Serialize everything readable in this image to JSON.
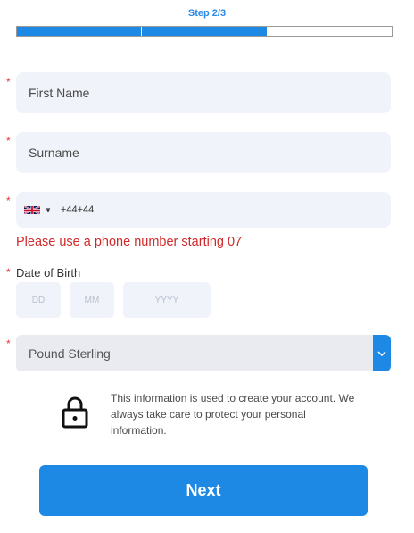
{
  "header": {
    "step_label": "Step 2/3",
    "progress": {
      "current_step": 2,
      "total_steps": 3
    }
  },
  "form": {
    "first_name": {
      "placeholder": "First Name",
      "required": true
    },
    "surname": {
      "placeholder": "Surname",
      "required": true
    },
    "phone": {
      "country_icon": "uk-flag-icon",
      "value": "+44+44",
      "required": true
    },
    "phone_error": "Please use a phone number starting 07",
    "dob": {
      "label": "Date of Birth",
      "required": true,
      "day_placeholder": "DD",
      "month_placeholder": "MM",
      "year_placeholder": "YYYY"
    },
    "currency": {
      "selected": "Pound Sterling",
      "required": true
    }
  },
  "info": {
    "icon": "lock-icon",
    "text": "This information is used to create your account. We always take care to protect your personal information."
  },
  "actions": {
    "next_label": "Next"
  },
  "colors": {
    "accent": "#1e88e5",
    "error": "#d0292b",
    "required": "#e53935",
    "field_bg": "#f0f3f9"
  }
}
